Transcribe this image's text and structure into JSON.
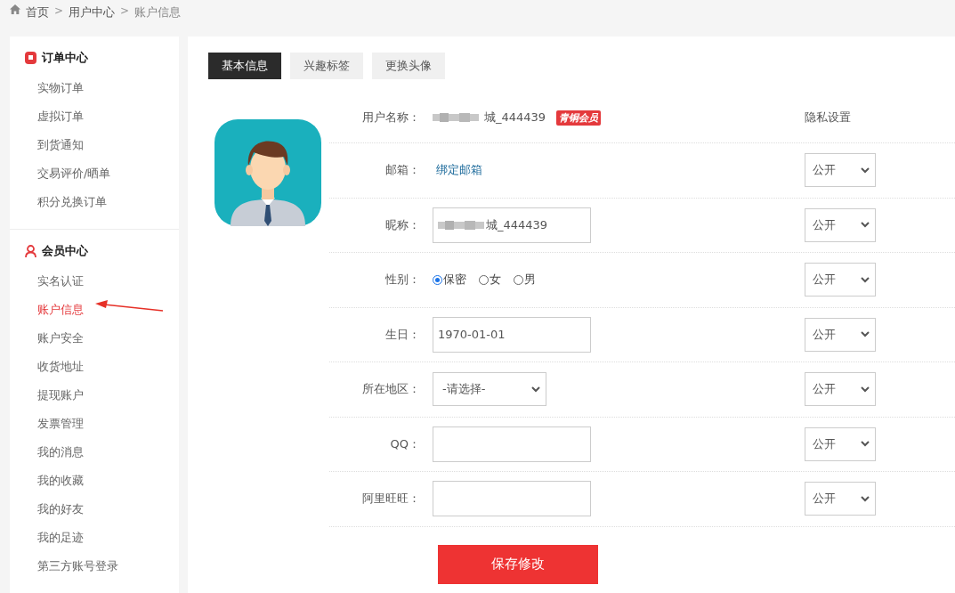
{
  "breadcrumb": {
    "items": [
      {
        "label": "首页",
        "kind": "home"
      },
      {
        "separator": ">",
        "label": "用户中心"
      },
      {
        "separator": ">",
        "label": "账户信息"
      }
    ]
  },
  "sidebar": {
    "sections": [
      {
        "title": "订单中心",
        "kind": "order",
        "items": [
          {
            "label": "实物订单",
            "selected": false
          },
          {
            "label": "虚拟订单",
            "selected": false
          },
          {
            "label": "到货通知",
            "selected": false
          },
          {
            "label": "交易评价/晒单",
            "selected": false
          },
          {
            "label": "积分兑换订单",
            "selected": false
          }
        ]
      },
      {
        "title": "会员中心",
        "kind": "member",
        "items": [
          {
            "label": "实名认证",
            "selected": false
          },
          {
            "label": "账户信息",
            "selected": true,
            "arrow": true
          },
          {
            "label": "账户安全",
            "selected": false
          },
          {
            "label": "收货地址",
            "selected": false
          },
          {
            "label": "提现账户",
            "selected": false
          },
          {
            "label": "发票管理",
            "selected": false
          },
          {
            "label": "我的消息",
            "selected": false
          },
          {
            "label": "我的收藏",
            "selected": false
          },
          {
            "label": "我的好友",
            "selected": false
          },
          {
            "label": "我的足迹",
            "selected": false
          },
          {
            "label": "第三方账号登录",
            "selected": false
          }
        ]
      }
    ]
  },
  "tabs": [
    {
      "label": "基本信息",
      "selected": true
    },
    {
      "label": "兴趣标签",
      "selected": false
    },
    {
      "label": "更换头像",
      "selected": false
    }
  ],
  "form": {
    "privacy_header": "隐私设置",
    "rows": [
      {
        "kind": "text",
        "label": "用户名称：",
        "value": "城_444439",
        "redacted": true,
        "badge": "青铜会员"
      },
      {
        "kind": "link",
        "label": "邮箱：",
        "value": "绑定邮箱",
        "privacy": "公开"
      },
      {
        "kind": "input",
        "label": "昵称：",
        "value": "城_444439",
        "redacted": true,
        "privacy": "公开"
      },
      {
        "kind": "radio",
        "label": "性别：",
        "options": [
          {
            "label": "保密",
            "selected": true
          },
          {
            "label": "女",
            "selected": false
          },
          {
            "label": "男",
            "selected": false
          }
        ],
        "privacy": "公开"
      },
      {
        "kind": "input",
        "label": "生日：",
        "value": "1970-01-01",
        "privacy": "公开"
      },
      {
        "kind": "select",
        "label": "所在地区：",
        "value": "-请选择-",
        "privacy": "公开"
      },
      {
        "kind": "input",
        "label": "QQ：",
        "privacy": "公开"
      },
      {
        "kind": "input",
        "label": "阿里旺旺：",
        "privacy": "公开"
      }
    ],
    "submit": "保存修改"
  }
}
